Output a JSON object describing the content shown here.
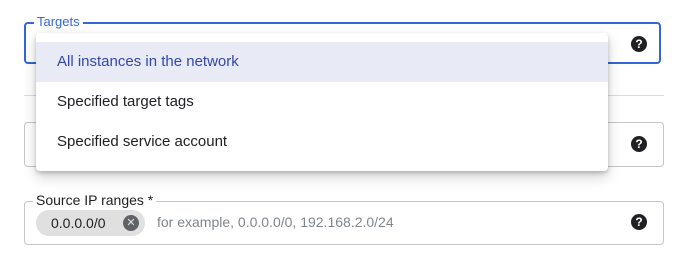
{
  "targets": {
    "label": "Targets",
    "options": [
      "All instances in the network",
      "Specified target tags",
      "Specified service account"
    ],
    "selected": "All instances in the network"
  },
  "source_ip_ranges": {
    "label": "Source IP ranges *",
    "chips": [
      "0.0.0.0/0"
    ],
    "placeholder": "for example, 0.0.0.0/0, 192.168.2.0/24"
  },
  "help_icon_glyph": "?",
  "chip_remove_glyph": "✕",
  "icons": {
    "help": "help-icon",
    "chip_remove": "close-icon"
  },
  "colors": {
    "focus_border": "#3367d6",
    "selected_bg": "#e8eaf6",
    "selected_text": "#3249a8",
    "chip_bg": "#e0e0e0"
  }
}
